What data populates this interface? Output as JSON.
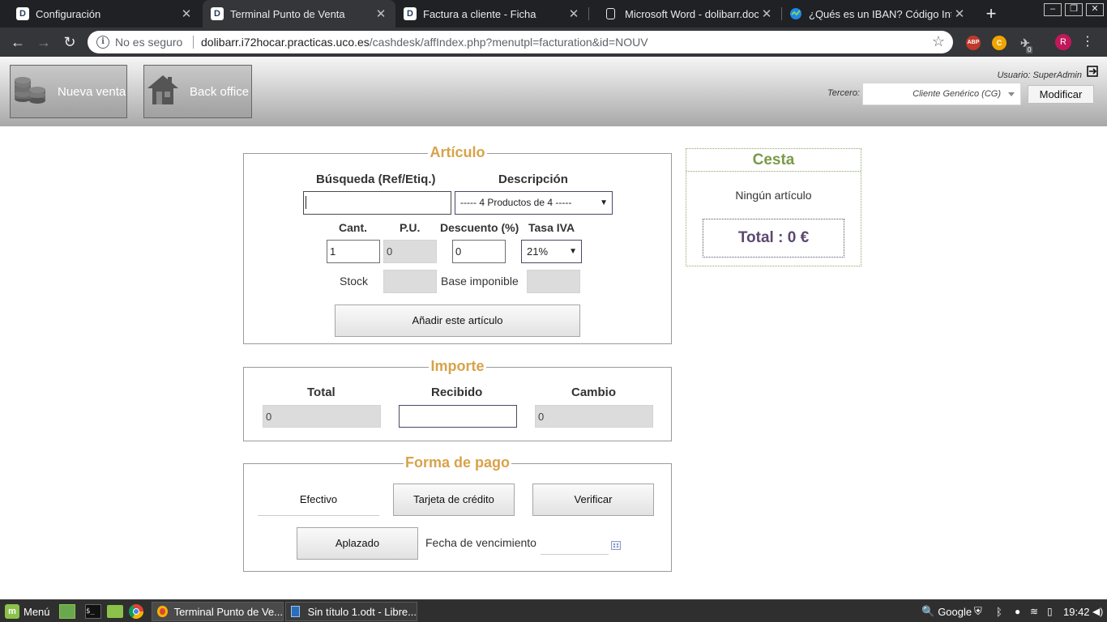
{
  "browser": {
    "tabs": [
      {
        "title": "Configuración",
        "favicon": "dolibarr-icon",
        "active": false
      },
      {
        "title": "Terminal Punto de Venta",
        "favicon": "dolibarr-icon",
        "active": true
      },
      {
        "title": "Factura a cliente - Ficha",
        "favicon": "dolibarr-icon",
        "active": false
      },
      {
        "title": "Microsoft Word - dolibarr.docx",
        "favicon": "document-icon",
        "active": false
      },
      {
        "title": "¿Qués es un IBAN? Código Inte",
        "favicon": "iban-site-icon",
        "active": false
      }
    ],
    "security_label": "No es seguro",
    "url_host": "dolibarr.i72hocar.practicas.uco.es",
    "url_path": "/cashdesk/affIndex.php?menutpl=facturation&id=NOUV",
    "extension_badge": "0",
    "profile_initial": "R",
    "ext_labels": {
      "abp": "ABP"
    }
  },
  "header": {
    "nueva_venta": "Nueva venta",
    "back_office": "Back office",
    "user_line": "Usuario: SuperAdmin",
    "tercero_label": "Tercero:",
    "tercero_value": "Cliente Genérico (CG)",
    "modificar": "Modificar"
  },
  "articulo": {
    "legend": "Artículo",
    "busqueda_label": "Búsqueda (Ref/Etiq.)",
    "busqueda_value": "",
    "descripcion_label": "Descripción",
    "descripcion_value": "----- 4 Productos de 4 -----",
    "cant_label": "Cant.",
    "cant_value": "1",
    "pu_label": "P.U.",
    "pu_value": "0",
    "descuento_label": "Descuento (%)",
    "descuento_value": "0",
    "tasa_label": "Tasa IVA",
    "tasa_value": "21%",
    "stock_label": "Stock",
    "stock_value": "",
    "base_label": "Base imponible",
    "base_value": "",
    "add_button": "Añadir este artículo"
  },
  "importe": {
    "legend": "Importe",
    "total_label": "Total",
    "total_value": "0",
    "recibido_label": "Recibido",
    "recibido_value": "",
    "cambio_label": "Cambio",
    "cambio_value": "0"
  },
  "pago": {
    "legend": "Forma de pago",
    "efectivo": "Efectivo",
    "tarjeta": "Tarjeta de crédito",
    "verificar": "Verificar",
    "aplazado": "Aplazado",
    "fecha_label": "Fecha de vencimiento :",
    "fecha_value": ""
  },
  "cesta": {
    "title": "Cesta",
    "empty": "Ningún artículo",
    "total": "Total : 0 €"
  },
  "taskbar": {
    "menu": "Menú",
    "windows": [
      "Terminal Punto de Ve...",
      "Sin título 1.odt - Libre..."
    ],
    "search": "Google",
    "clock": "19:42"
  },
  "colors": {
    "legend": "#d8a24a",
    "cesta_title": "#7a9a48",
    "cesta_total": "#5d4870"
  }
}
